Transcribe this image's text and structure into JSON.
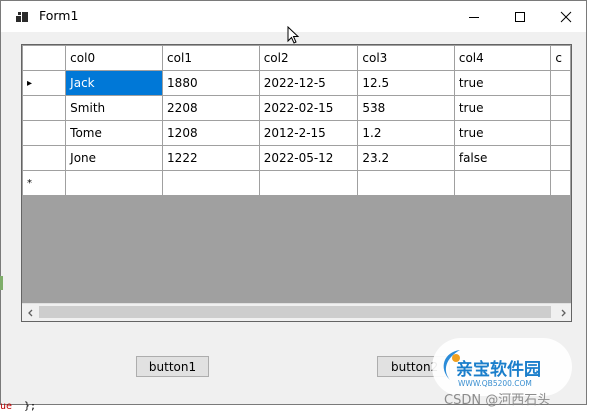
{
  "window": {
    "title": "Form1"
  },
  "grid": {
    "columns": [
      "col0",
      "col1",
      "col2",
      "col3",
      "col4"
    ],
    "rows": [
      [
        "Jack",
        "1880",
        "2022-12-5",
        "12.5",
        "true"
      ],
      [
        "Smith",
        "2208",
        "2022-02-15",
        "538",
        "true"
      ],
      [
        "Tome",
        "1208",
        "2012-2-15",
        "1.2",
        "true"
      ],
      [
        "Jone",
        "1222",
        "2022-05-12",
        "23.2",
        "false"
      ]
    ],
    "current_row_marker": "▸",
    "new_row_marker": "*",
    "partial_header": "c"
  },
  "buttons": {
    "button1": "button1",
    "button2": "button2"
  },
  "watermark": {
    "name": "亲宝软件园",
    "url": "WWW.QB5200.COM",
    "csdn": "CSDN @河西石头"
  },
  "background_code": {
    "fragment": "ue",
    "brace": "};"
  },
  "colors": {
    "selection": "#0078d7",
    "window_bg": "#f0f0f0",
    "grid_bg": "#a0a0a0"
  }
}
